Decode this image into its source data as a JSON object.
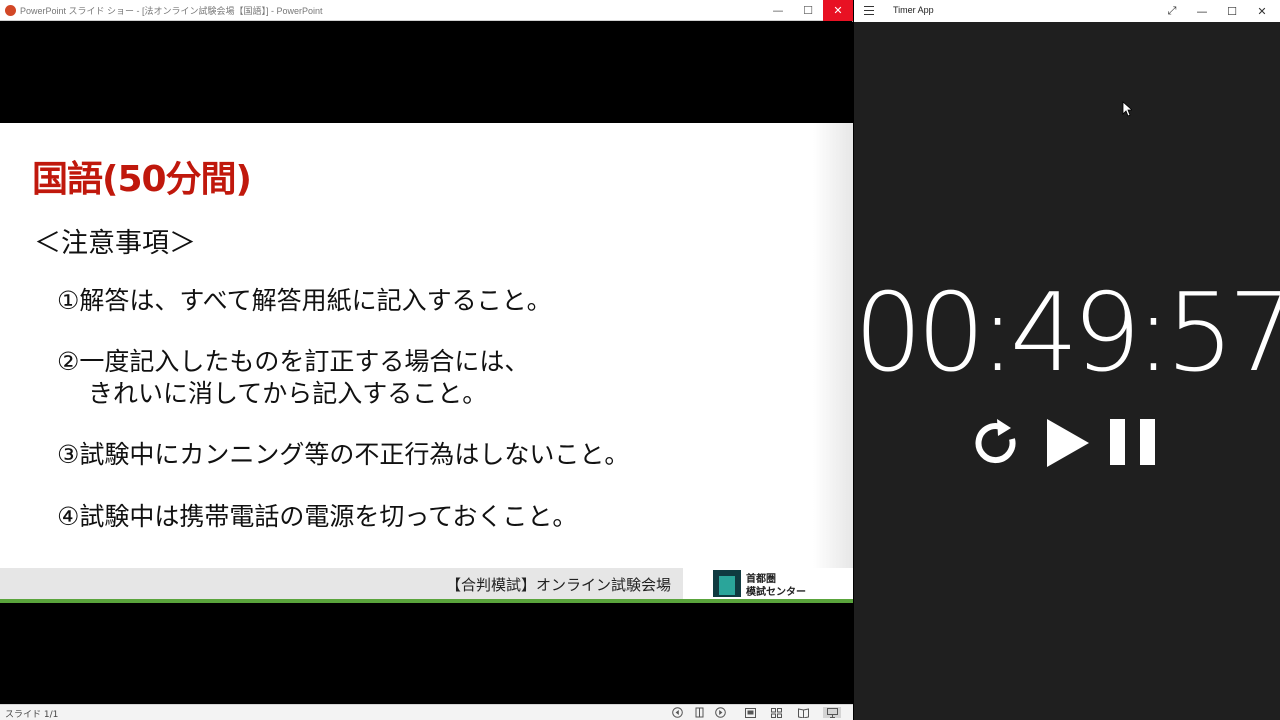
{
  "ppt": {
    "window_title": "PowerPoint スライド ショー - [法オンライン試験会場【国語】] - PowerPoint",
    "minimize": "—",
    "maximize": "☐",
    "close": "✕",
    "status": "スライド 1/1",
    "slide": {
      "heading": "国語(50分間)",
      "notes_heading": "＜注意事項＞",
      "notes": [
        "①解答は、すべて解答用紙に記入すること。",
        "②一度記入したものを訂正する場合には、",
        "きれいに消してから記入すること。",
        "③試験中にカンニング等の不正行為はしないこと。",
        "④試験中は携帯電話の電源を切っておくこと。"
      ],
      "footer_text": "【合判模試】オンライン試験会場",
      "logo_line1": "首都圏",
      "logo_line2": "模試センター"
    }
  },
  "timer": {
    "window_title": "Timer App",
    "time": "00:49:57",
    "expand": "⤢",
    "minimize": "—",
    "maximize": "☐",
    "close": "✕"
  },
  "colors": {
    "heading_red": "#c0180c",
    "footer_green": "#5aa43c",
    "logo_teal": "#2aa59a",
    "timer_bg": "#1f1f1f"
  }
}
